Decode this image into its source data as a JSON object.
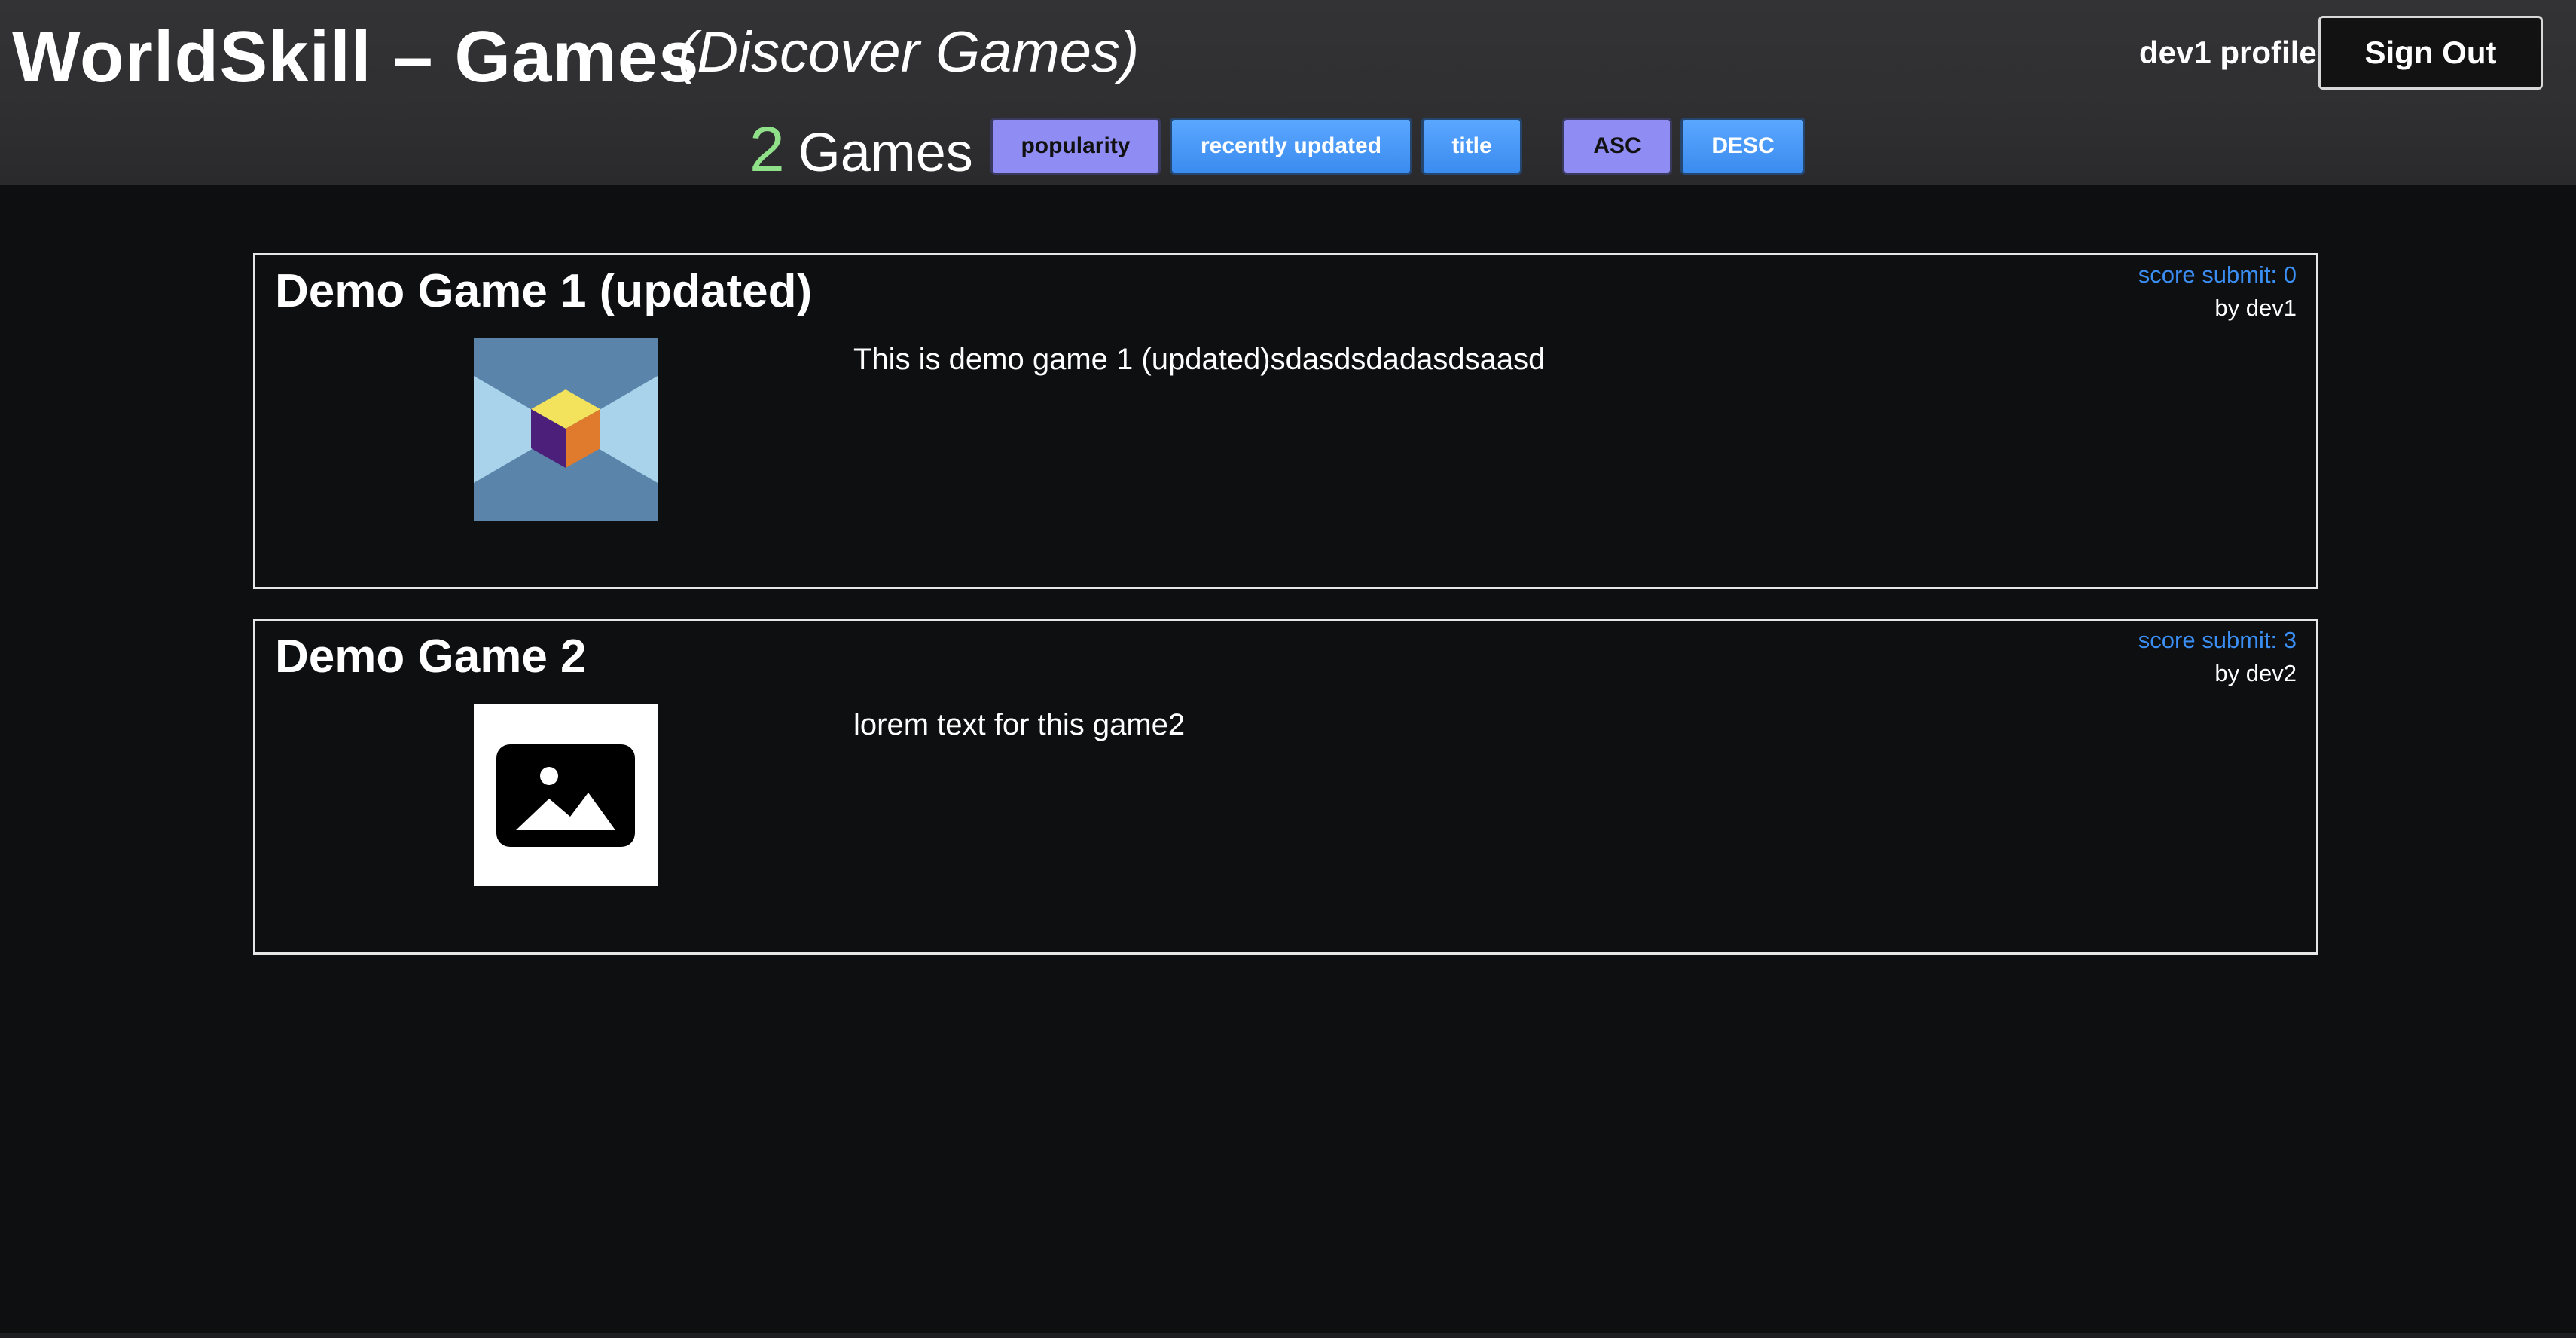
{
  "header": {
    "title": "WorldSkill – Games",
    "subtitle": "(Discover Games)",
    "profile_label": "dev1 profile",
    "signout_label": "Sign Out"
  },
  "toolbar": {
    "count": "2",
    "count_label": "Games",
    "sort_fields": [
      {
        "label": "popularity",
        "style": "purple"
      },
      {
        "label": "recently updated",
        "style": "blue"
      },
      {
        "label": "title",
        "style": "blue"
      }
    ],
    "sort_orders": [
      {
        "label": "ASC",
        "style": "purple"
      },
      {
        "label": "DESC",
        "style": "blue"
      }
    ]
  },
  "games": [
    {
      "title": "Demo Game 1 (updated)",
      "score": "score submit: 0",
      "author": "by dev1",
      "description": "This is demo game 1 (updated)sdasdsdadasdsaasd",
      "thumbnail_icon": "cube-logo-icon"
    },
    {
      "title": "Demo Game 2",
      "score": "score submit: 3",
      "author": "by dev2",
      "description": "lorem text for this game2",
      "thumbnail_icon": "image-placeholder-icon"
    }
  ],
  "colors": {
    "background": "#0e0f11",
    "header": "#2f2f31",
    "accent_green": "#90e08a",
    "button_purple": "#8f8cf3",
    "button_blue": "#3b8cf0",
    "link_blue": "#3b8ef3"
  }
}
